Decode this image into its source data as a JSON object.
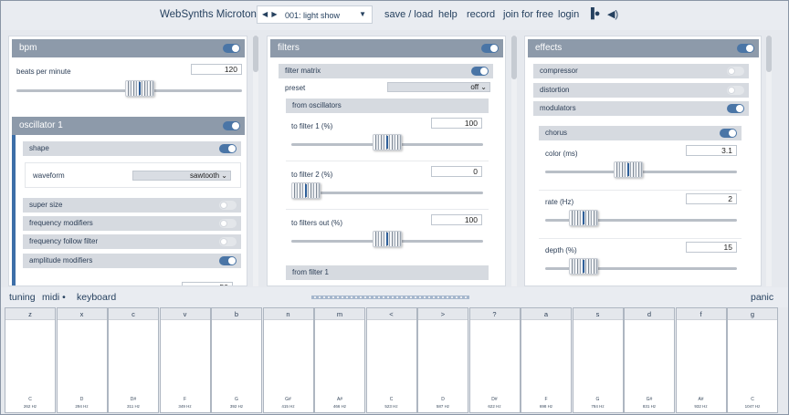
{
  "header": {
    "title": "WebSynths Microtonal",
    "preset_name": "001: light show",
    "menu": [
      "save / load",
      "help",
      "record",
      "join for free",
      "login"
    ]
  },
  "bpm_panel": {
    "title": "bpm",
    "label": "beats per minute",
    "value": "120",
    "slider_fraction": 0.5
  },
  "oscillator_panel": {
    "title": "oscillator 1",
    "shape_label": "shape",
    "waveform_label": "waveform",
    "waveform_value": "sawtooth",
    "rows": [
      {
        "label": "super size",
        "on": false
      },
      {
        "label": "frequency modifiers",
        "on": false
      },
      {
        "label": "frequency follow filter",
        "on": false
      },
      {
        "label": "amplitude modifiers",
        "on": true
      }
    ],
    "partial_value": "50"
  },
  "filters_panel": {
    "title": "filters",
    "matrix_label": "filter matrix",
    "preset_label": "preset",
    "preset_value": "off",
    "from_osc_label": "from oscillators",
    "sliders": [
      {
        "label": "to filter 1 (%)",
        "value": "100",
        "fraction": 0.95
      },
      {
        "label": "to filter 2 (%)",
        "value": "0",
        "fraction": 0.0
      },
      {
        "label": "to filters out (%)",
        "value": "100",
        "fraction": 0.95
      }
    ],
    "from_filter_label": "from filter 1"
  },
  "effects_panel": {
    "title": "effects",
    "rows": [
      {
        "label": "compressor",
        "on": false
      },
      {
        "label": "distortion",
        "on": false
      },
      {
        "label": "modulators",
        "on": true
      }
    ],
    "chorus_label": "chorus",
    "sliders": [
      {
        "label": "color (ms)",
        "value": "3.1",
        "fraction": 0.45
      },
      {
        "label": "rate (Hz)",
        "value": "2",
        "fraction": 0.2
      },
      {
        "label": "depth (%)",
        "value": "15",
        "fraction": 0.2
      }
    ]
  },
  "bottom": {
    "tuning": "tuning",
    "midi": "midi •",
    "keyboard": "keyboard",
    "panic": "panic"
  },
  "keys": [
    {
      "letter": "z",
      "note": "C",
      "hz": "262 Hz"
    },
    {
      "letter": "x",
      "note": "D",
      "hz": "294 Hz"
    },
    {
      "letter": "c",
      "note": "D#",
      "hz": "311 Hz"
    },
    {
      "letter": "v",
      "note": "F",
      "hz": "349 Hz"
    },
    {
      "letter": "b",
      "note": "G",
      "hz": "392 Hz"
    },
    {
      "letter": "n",
      "note": "G#",
      "hz": "415 Hz"
    },
    {
      "letter": "m",
      "note": "A#",
      "hz": "466 Hz"
    },
    {
      "letter": "<",
      "note": "C",
      "hz": "523 Hz"
    },
    {
      "letter": ">",
      "note": "D",
      "hz": "587 Hz"
    },
    {
      "letter": "?",
      "note": "D#",
      "hz": "622 Hz"
    },
    {
      "letter": "a",
      "note": "F",
      "hz": "698 Hz"
    },
    {
      "letter": "s",
      "note": "G",
      "hz": "784 Hz"
    },
    {
      "letter": "d",
      "note": "G#",
      "hz": "831 Hz"
    },
    {
      "letter": "f",
      "note": "A#",
      "hz": "932 Hz"
    },
    {
      "letter": "g",
      "note": "C",
      "hz": "1047 Hz"
    }
  ],
  "colors": {
    "accent": "#4a75a6",
    "panel_header": "#8d9aaa",
    "sub_header": "#d6dae0",
    "background": "#e6e9ee"
  }
}
